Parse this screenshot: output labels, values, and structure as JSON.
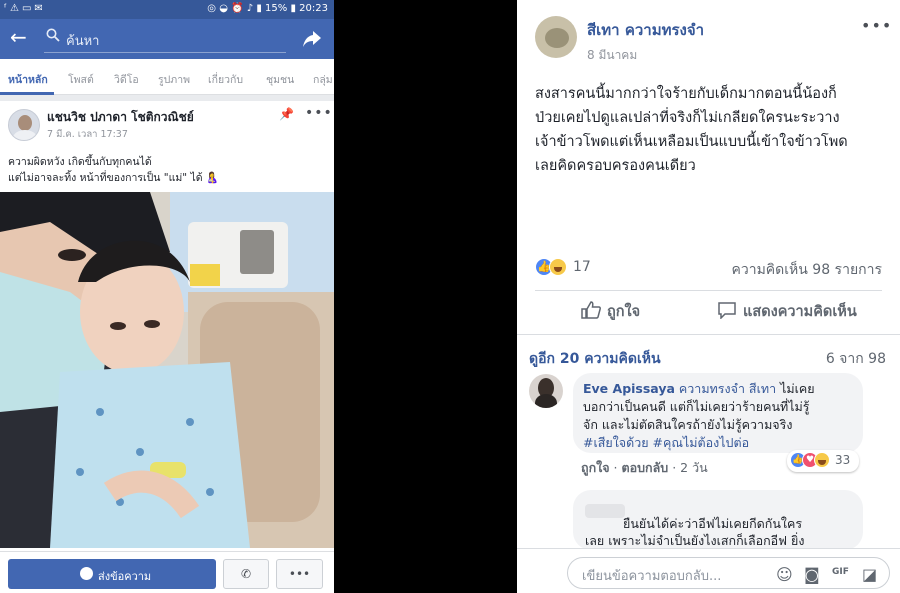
{
  "left_screen": {
    "status_bar": {
      "icons_left": [
        "facebook-notification-icon",
        "warning-icon",
        "line-notification-icon",
        "mail-icon"
      ],
      "icons_right": [
        "data-saver-icon",
        "wifi-icon",
        "alarm-icon",
        "sound-icon",
        "signal-icon"
      ],
      "battery": "15%",
      "time": "20:23"
    },
    "search": {
      "placeholder": "ค้นหา"
    },
    "tabs": [
      {
        "label": "หน้าหลัก",
        "active": true
      },
      {
        "label": "โพสต์",
        "active": false
      },
      {
        "label": "วิดีโอ",
        "active": false
      },
      {
        "label": "รูปภาพ",
        "active": false
      },
      {
        "label": "เกี่ยวกับ",
        "active": false
      },
      {
        "label": "ชุมชน",
        "active": false
      },
      {
        "label": "กลุ่ม",
        "active": false
      }
    ],
    "post": {
      "author": "แชนวิช ปภาดา โชติกวณิชย์",
      "time": "7 มี.ค. เวลา 17:37",
      "line1": "ความผิดหวัง เกิดขึ้นกับทุกคนได้",
      "line2": "แต่ไม่อาจละทิ้ง หน้าที่ของการเป็น \"แม่\" ได้",
      "line2_emoji": "🤱"
    },
    "bottom_bar": {
      "message_button": "ส่งข้อความ",
      "call_icon": "phone-icon",
      "more_icon": "more-dots-icon"
    }
  },
  "right_panel": {
    "page_name": "สีเทา ความทรงจำ",
    "date": "8 มีนาคม",
    "body_lines": [
      "สงสารคนนี้มากกว่าใจร้ายกับเด็กมากตอนนี้น้องก็",
      "ป่วยเคยไปดูแลเปล่าที่จริงก็ไม่เกลียดใครนะระวาง",
      "เจ้าข้าวโพดแต่เห็นเหลือมเป็นแบบนี้เข้าใจข้าวโพด",
      "เลยคิดครอบครองคนเดียว"
    ],
    "reactions": {
      "icons": [
        "like-reaction-icon",
        "haha-reaction-icon"
      ],
      "count": "17"
    },
    "comments_count": "ความคิดเห็น 98 รายการ",
    "actions": {
      "like": "ถูกใจ",
      "comment": "แสดงความคิดเห็น"
    },
    "more_comments": "ดูอีก 20 ความคิดเห็น",
    "pager": "6 จาก 98",
    "comment1": {
      "name": "Eve Apissaya",
      "tag": "ความทรงจำ สีเทา",
      "l1_tail": "ไม่เคย",
      "line2": "บอกว่าเป็นคนดี แต่ก็ไม่เคยว่าร้ายคนที่ไม่รู้",
      "line3": "จัก และไม่ตัดสินใครถ้ายังไม่รู้ความจริง",
      "hashtags": "#เสียใจด้วย #คุณไม่ต้องไปต่อ",
      "like": "ถูกใจ",
      "reply": "ตอบกลับ",
      "time": "2 วัน",
      "reaction_icons": [
        "like-reaction-icon",
        "love-reaction-icon",
        "haha-reaction-icon"
      ],
      "reaction_count": "33"
    },
    "comment2": {
      "line1": "ยืนยันได้ค่ะว่าอีฟไม่เคยกีดกันใคร",
      "line2": "เลย เพราะไม่จำเป็นยังไงเสกก็เลือกอีฟ ยิ่ง"
    },
    "composer": {
      "placeholder": "เขียนข้อความตอบกลับ...",
      "icons": [
        "emoji-icon",
        "camera-icon",
        "gif-icon",
        "sticker-icon"
      ]
    }
  }
}
